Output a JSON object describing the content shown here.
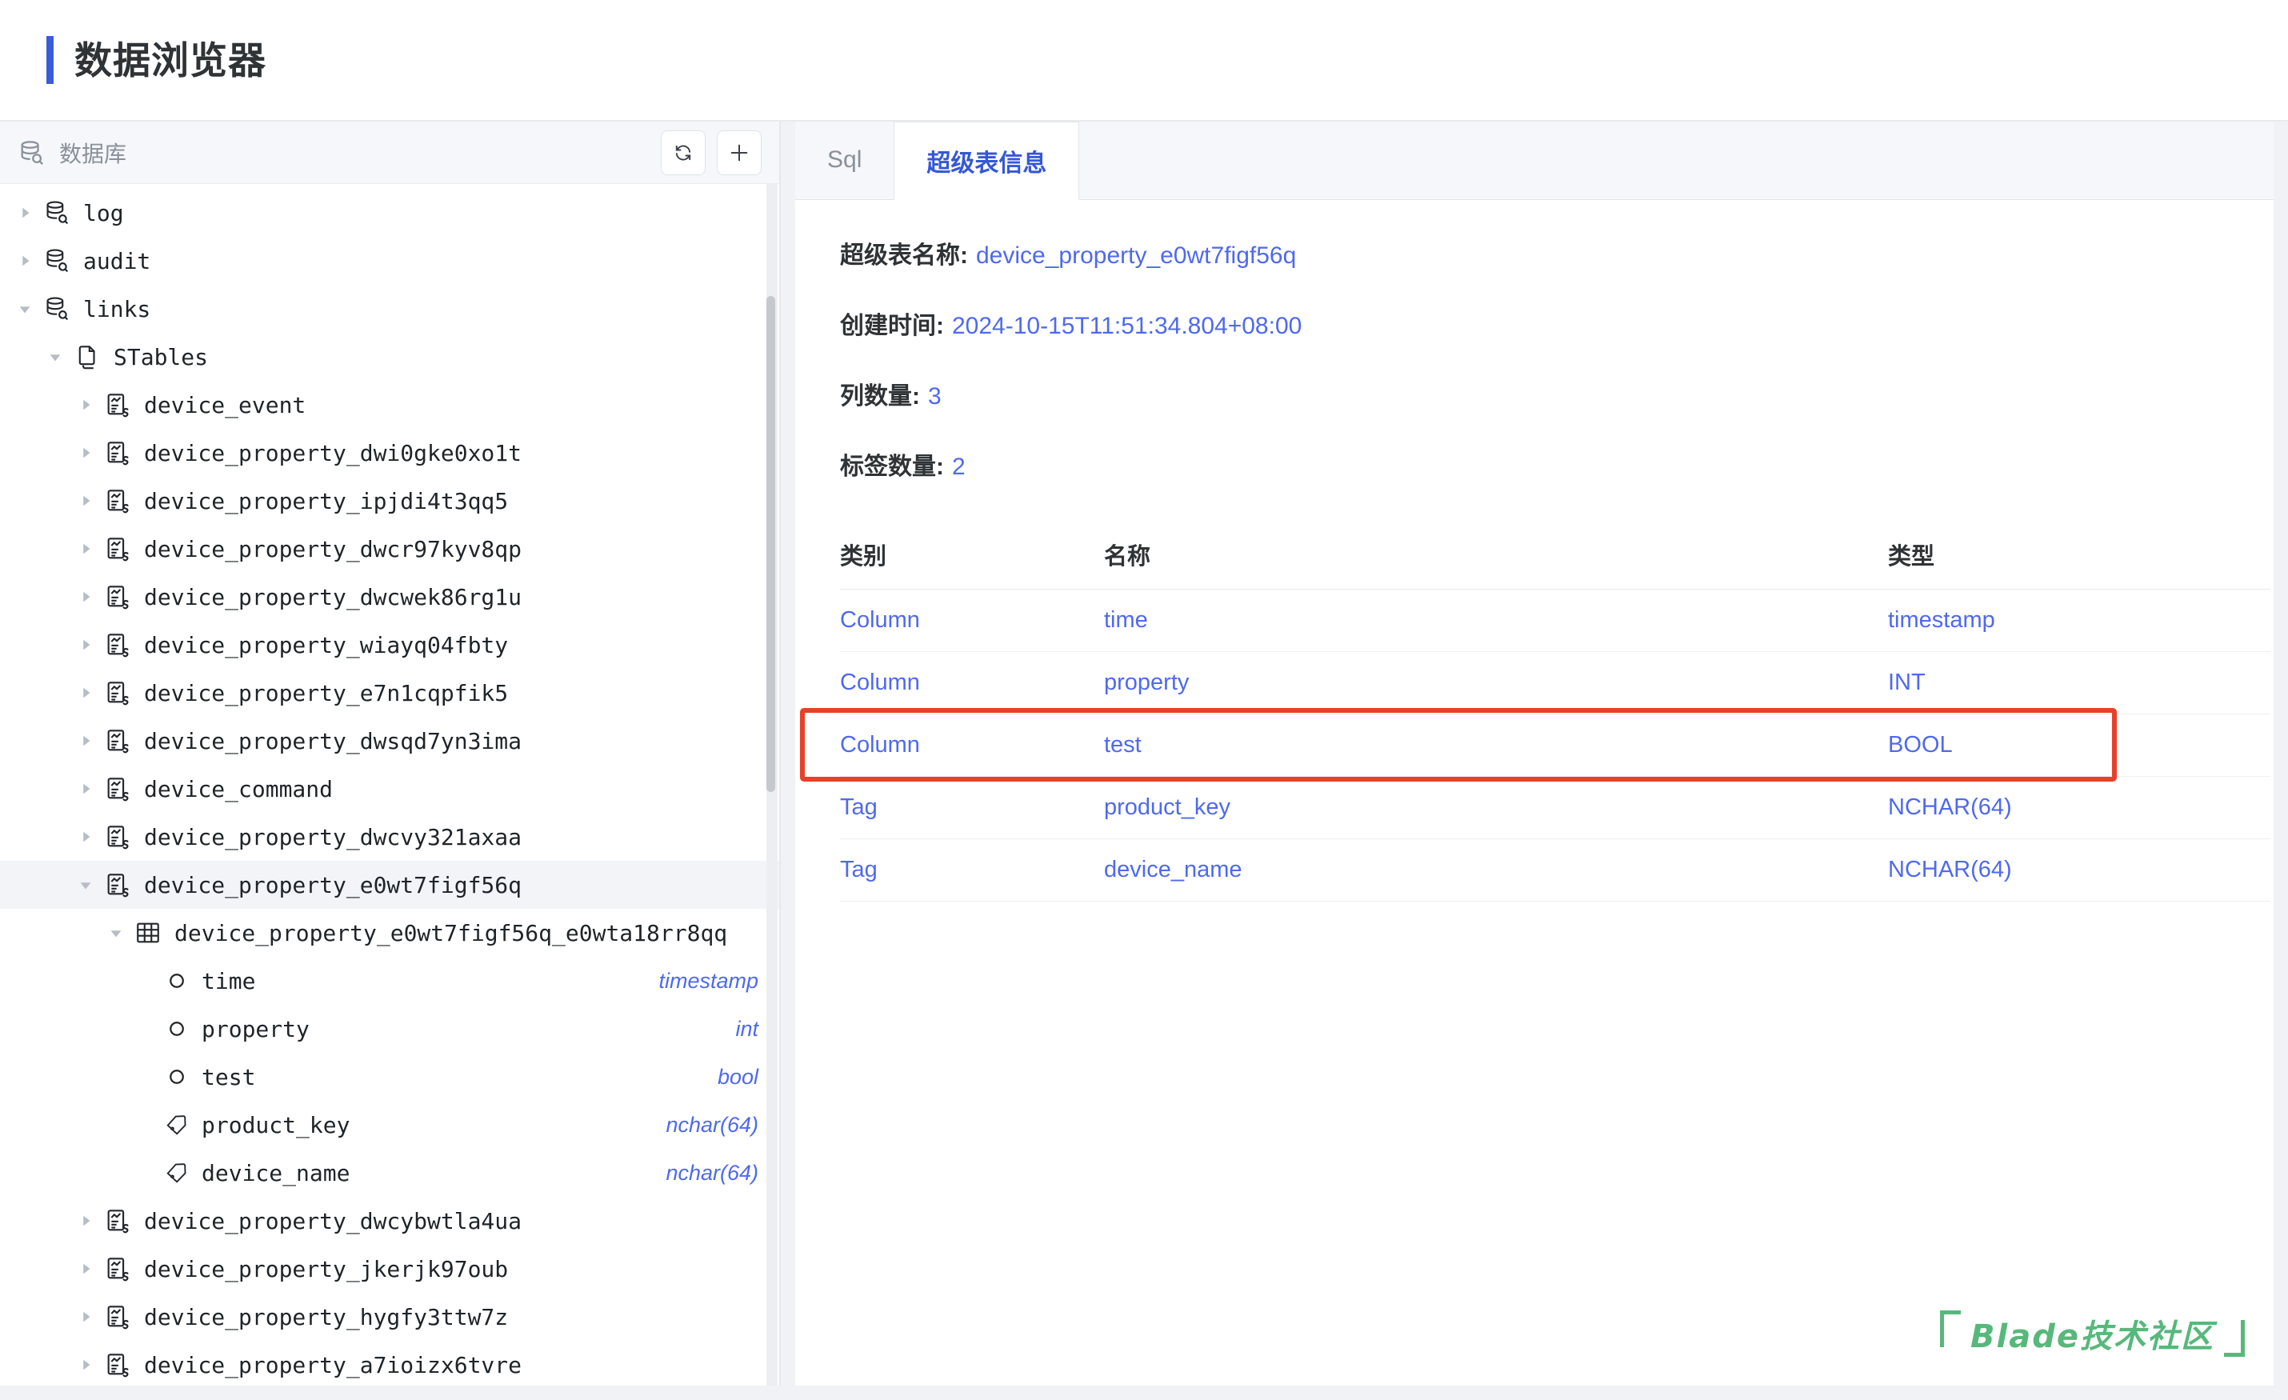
{
  "header": {
    "title": "数据浏览器",
    "accent_color": "#3b5bdb"
  },
  "sidebar": {
    "panel_label": "数据库",
    "db_icon": "database-search-icon",
    "refresh_icon": "refresh-icon",
    "add_icon": "plus-icon",
    "tree": [
      {
        "label": "log",
        "icon": "database-icon",
        "indent": 0,
        "caret": "collapsed",
        "type": ""
      },
      {
        "label": "audit",
        "icon": "database-icon",
        "indent": 0,
        "caret": "collapsed",
        "type": ""
      },
      {
        "label": "links",
        "icon": "database-icon",
        "indent": 0,
        "caret": "expanded",
        "type": ""
      },
      {
        "label": "STables",
        "icon": "stack-icon",
        "indent": 1,
        "caret": "expanded",
        "type": ""
      },
      {
        "label": "device_event",
        "icon": "stable-icon",
        "indent": 2,
        "caret": "collapsed",
        "type": ""
      },
      {
        "label": "device_property_dwi0gke0xo1t",
        "icon": "stable-icon",
        "indent": 2,
        "caret": "collapsed",
        "type": ""
      },
      {
        "label": "device_property_ipjdi4t3qq5",
        "icon": "stable-icon",
        "indent": 2,
        "caret": "collapsed",
        "type": ""
      },
      {
        "label": "device_property_dwcr97kyv8qp",
        "icon": "stable-icon",
        "indent": 2,
        "caret": "collapsed",
        "type": ""
      },
      {
        "label": "device_property_dwcwek86rg1u",
        "icon": "stable-icon",
        "indent": 2,
        "caret": "collapsed",
        "type": ""
      },
      {
        "label": "device_property_wiayq04fbty",
        "icon": "stable-icon",
        "indent": 2,
        "caret": "collapsed",
        "type": ""
      },
      {
        "label": "device_property_e7n1cqpfik5",
        "icon": "stable-icon",
        "indent": 2,
        "caret": "collapsed",
        "type": ""
      },
      {
        "label": "device_property_dwsqd7yn3ima",
        "icon": "stable-icon",
        "indent": 2,
        "caret": "collapsed",
        "type": ""
      },
      {
        "label": "device_command",
        "icon": "stable-icon",
        "indent": 2,
        "caret": "collapsed",
        "type": ""
      },
      {
        "label": "device_property_dwcvy321axaa",
        "icon": "stable-icon",
        "indent": 2,
        "caret": "collapsed",
        "type": ""
      },
      {
        "label": "device_property_e0wt7figf56q",
        "icon": "stable-icon",
        "indent": 2,
        "caret": "expanded",
        "type": "",
        "selected": true
      },
      {
        "label": "device_property_e0wt7figf56q_e0wta18rr8qq",
        "icon": "table-grid-icon",
        "indent": 3,
        "caret": "expanded",
        "type": ""
      },
      {
        "label": "time",
        "icon": "column-circle-icon",
        "indent": 4,
        "caret": "none",
        "type": "timestamp"
      },
      {
        "label": "property",
        "icon": "column-circle-icon",
        "indent": 4,
        "caret": "none",
        "type": "int"
      },
      {
        "label": "test",
        "icon": "column-circle-icon",
        "indent": 4,
        "caret": "none",
        "type": "bool"
      },
      {
        "label": "product_key",
        "icon": "tag-icon",
        "indent": 4,
        "caret": "none",
        "type": "nchar(64)"
      },
      {
        "label": "device_name",
        "icon": "tag-icon",
        "indent": 4,
        "caret": "none",
        "type": "nchar(64)"
      },
      {
        "label": "device_property_dwcybwtla4ua",
        "icon": "stable-icon",
        "indent": 2,
        "caret": "collapsed",
        "type": ""
      },
      {
        "label": "device_property_jkerjk97oub",
        "icon": "stable-icon",
        "indent": 2,
        "caret": "collapsed",
        "type": ""
      },
      {
        "label": "device_property_hygfy3ttw7z",
        "icon": "stable-icon",
        "indent": 2,
        "caret": "collapsed",
        "type": ""
      },
      {
        "label": "device_property_a7ioizx6tvre",
        "icon": "stable-icon",
        "indent": 2,
        "caret": "collapsed",
        "type": ""
      }
    ]
  },
  "main": {
    "tabs": [
      {
        "label": "Sql",
        "active": false
      },
      {
        "label": "超级表信息",
        "active": true
      }
    ],
    "info": [
      {
        "label": "超级表名称:",
        "value": "device_property_e0wt7figf56q"
      },
      {
        "label": "创建时间:",
        "value": "2024-10-15T11:51:34.804+08:00"
      },
      {
        "label": "列数量:",
        "value": "3"
      },
      {
        "label": "标签数量:",
        "value": "2"
      }
    ],
    "table": {
      "columns": [
        "类别",
        "名称",
        "类型"
      ],
      "rows": [
        {
          "category": "Column",
          "name": "time",
          "type": "timestamp",
          "highlighted": false
        },
        {
          "category": "Column",
          "name": "property",
          "type": "INT",
          "highlighted": false
        },
        {
          "category": "Column",
          "name": "test",
          "type": "BOOL",
          "highlighted": true
        },
        {
          "category": "Tag",
          "name": "product_key",
          "type": "NCHAR(64)",
          "highlighted": false
        },
        {
          "category": "Tag",
          "name": "device_name",
          "type": "NCHAR(64)",
          "highlighted": false
        }
      ],
      "highlight_color": "#e8402a"
    },
    "link_color": "#4f69ef"
  },
  "watermark": {
    "text": "Blade技术社区",
    "color": "#57b87b"
  }
}
